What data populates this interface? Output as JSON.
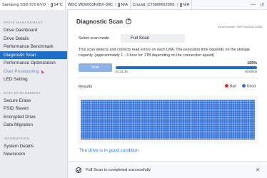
{
  "drive_tabs": [
    {
      "name": "Samsung SSD 970 EVO",
      "temp": "54°C"
    },
    {
      "name": "WDC WD6003FZBX-00C",
      "temp": "N/A"
    },
    {
      "name": "Crucial_CT500MX200S",
      "temp": "N/A"
    }
  ],
  "window_icons": {
    "minimize": "—",
    "refresh": "↺"
  },
  "sidebar": {
    "sections": [
      {
        "title": "DRIVE MANAGEMENT",
        "items": [
          "Drive Dashboard",
          "Drive Details",
          "Performance Benchmark",
          "Diagnostic Scan",
          "Performance Optimization",
          "Over Provisioning",
          "LED Setting"
        ]
      },
      {
        "title": "DATA MANAGEMENT",
        "items": [
          "Secure Erase",
          "PSID Revert",
          "Encrypted Drive",
          "Data Migration"
        ]
      },
      {
        "title": "INFORMATION",
        "items": [
          "System Details",
          "Newsroom"
        ]
      }
    ],
    "active_item": "Diagnostic Scan"
  },
  "main": {
    "title": "Diagnostic Scan",
    "help_icon": "?",
    "serial": "Serial Number: S5PCNZFN874235D",
    "scan_mode_label": "Select scan mode",
    "scan_mode_value": "Full Scan",
    "description": "This scan detects and corrects read errors on each LBA. The execution time depends on the storage capacity. (approximately 1 - 3 hour for 1TB depending on the connection speed)",
    "start_label": "Start",
    "progress_percent": "100%",
    "progress_value": 1.0,
    "time_elapsed": "01:41:34",
    "time_remaining": "00:00:00",
    "results_label": "Results",
    "legend": [
      {
        "label": "Bad",
        "color": "#e02b2b"
      },
      {
        "label": "Good",
        "color": "#2e6fd9"
      }
    ],
    "status_text": "The drive is in good condition"
  },
  "toast": {
    "message": "Full Scan is completed successfully",
    "close": "✕"
  },
  "colors": {
    "accent": "#1f6fc8",
    "good": "#2e6fd9",
    "bad": "#e02b2b"
  }
}
